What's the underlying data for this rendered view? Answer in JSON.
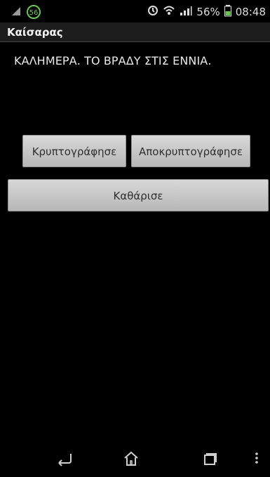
{
  "status_bar": {
    "notification_badge": "56",
    "battery_percent": "56%",
    "time": "08:48"
  },
  "app": {
    "title": "Καίσαρας"
  },
  "main": {
    "message": "ΚΑΛΗΜΕΡΑ. ΤΟ ΒΡΑΔΥ ΣΤΙΣ ΕΝΝΙΑ."
  },
  "buttons": {
    "encrypt": "Κρυπτογράφησε",
    "decrypt": "Αποκρυπτογράφησε",
    "clear": "Καθάρισε"
  },
  "icons": {
    "status_notification": "android-icon",
    "status_alarm": "alarm-icon",
    "status_wifi": "wifi-icon",
    "status_signal": "signal-icon",
    "status_battery": "battery-icon",
    "nav_back": "back-icon",
    "nav_home": "home-icon",
    "nav_recent": "recent-apps-icon",
    "nav_menu": "menu-icon"
  },
  "colors": {
    "background": "#000000",
    "badge_green": "#66c84f",
    "button_fill": "#c8c8c8"
  }
}
